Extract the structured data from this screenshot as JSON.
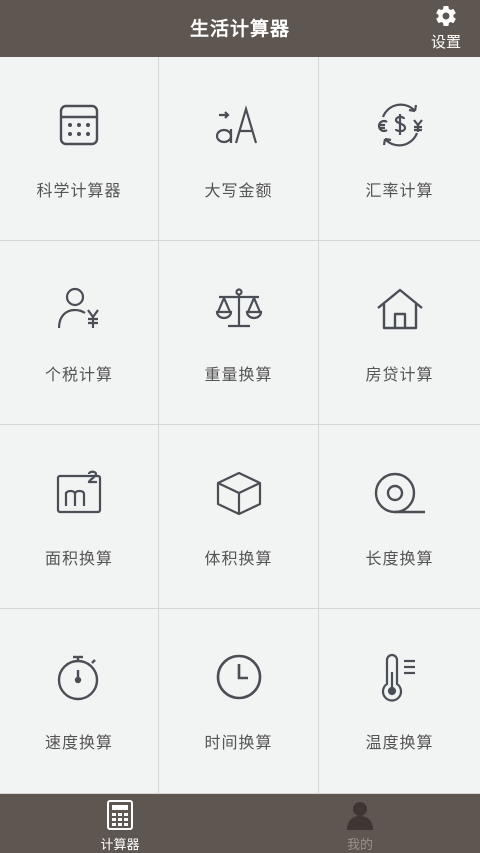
{
  "header": {
    "title": "生活计算器",
    "settings_label": "设置"
  },
  "grid": {
    "items": [
      {
        "label": "科学计算器",
        "icon": "calculator-icon"
      },
      {
        "label": "大写金额",
        "icon": "text-case-icon"
      },
      {
        "label": "汇率计算",
        "icon": "currency-exchange-icon"
      },
      {
        "label": "个税计算",
        "icon": "person-yen-icon"
      },
      {
        "label": "重量换算",
        "icon": "balance-scale-icon"
      },
      {
        "label": "房贷计算",
        "icon": "house-icon"
      },
      {
        "label": "面积换算",
        "icon": "square-meter-icon"
      },
      {
        "label": "体积换算",
        "icon": "cube-icon"
      },
      {
        "label": "长度换算",
        "icon": "tape-measure-icon"
      },
      {
        "label": "速度换算",
        "icon": "stopwatch-icon"
      },
      {
        "label": "时间换算",
        "icon": "clock-icon"
      },
      {
        "label": "温度换算",
        "icon": "thermometer-icon"
      }
    ]
  },
  "tabs": [
    {
      "label": "计算器",
      "icon": "calculator-tab-icon",
      "active": true
    },
    {
      "label": "我的",
      "icon": "user-tab-icon",
      "active": false
    }
  ],
  "colors": {
    "bar": "#5e5650",
    "background": "#f2f3f3",
    "icon_stroke": "#4a4e55"
  }
}
